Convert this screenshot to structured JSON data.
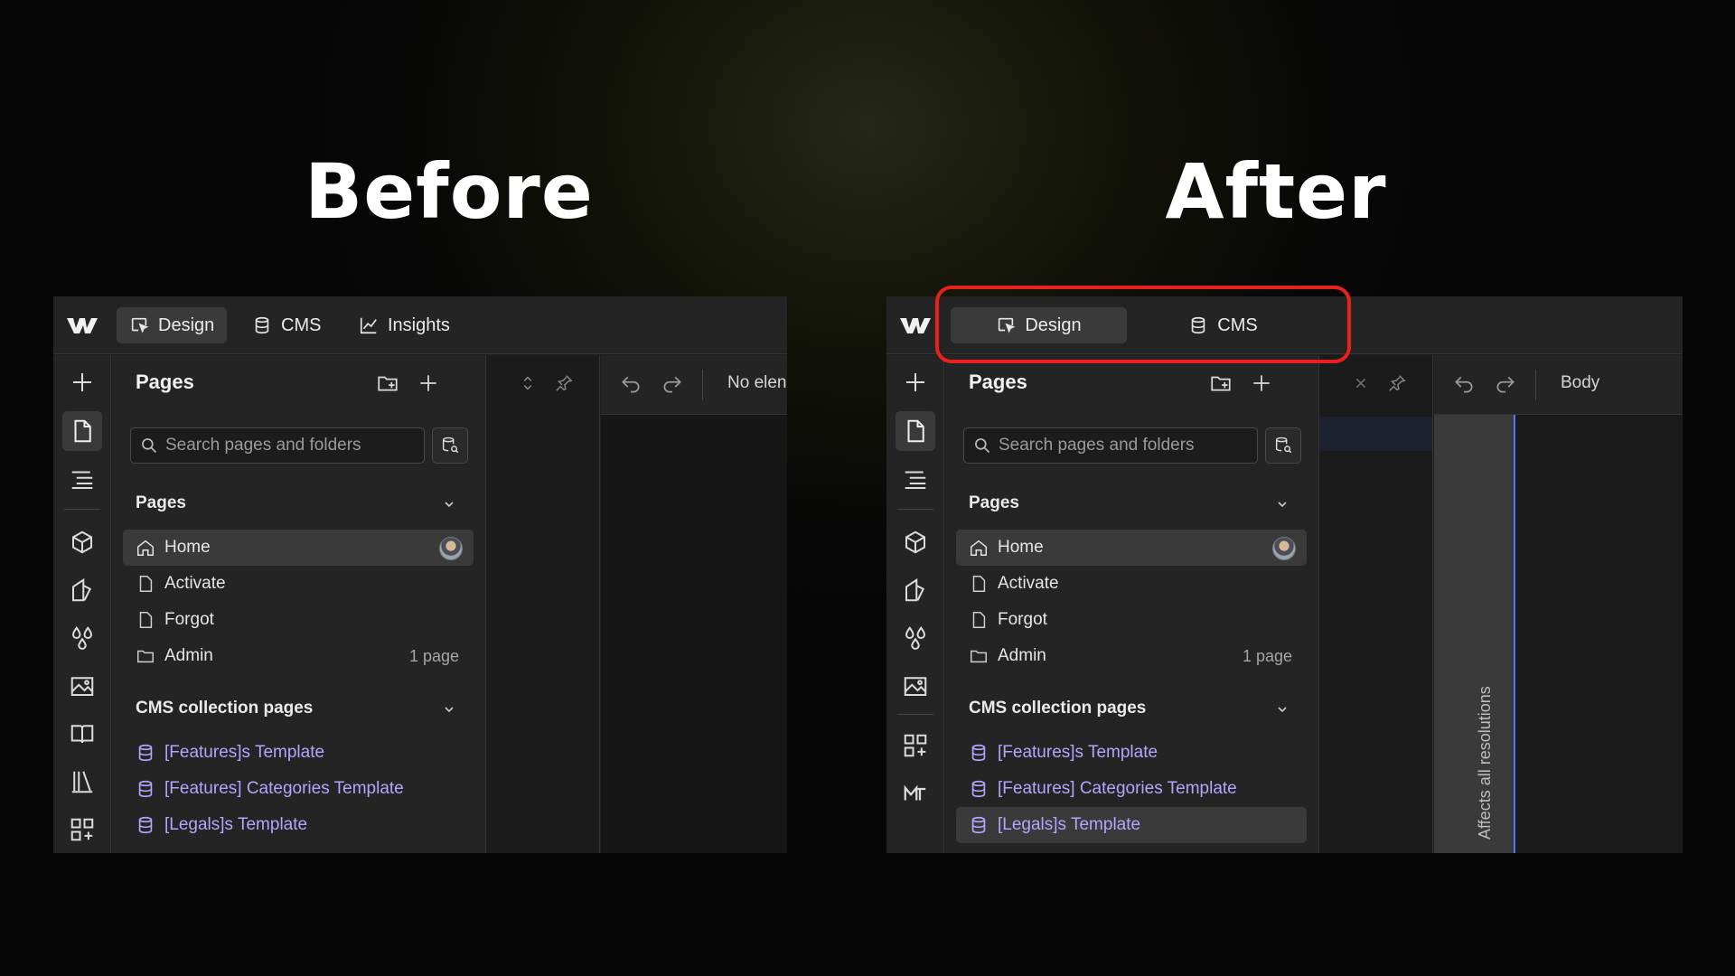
{
  "headings": {
    "before": "Before",
    "after": "After"
  },
  "colors": {
    "highlight": "#e8221b",
    "cms_link": "#b6a4ff",
    "selection": "#4a7bff"
  },
  "before": {
    "tabs": {
      "design": "Design",
      "cms": "CMS",
      "insights": "Insights"
    },
    "panel": {
      "title": "Pages",
      "search_placeholder": "Search pages and folders",
      "pages_section": "Pages",
      "pages": [
        {
          "label": "Home",
          "icon": "home-icon"
        },
        {
          "label": "Activate",
          "icon": "page-icon"
        },
        {
          "label": "Forgot",
          "icon": "page-icon"
        },
        {
          "label": "Admin",
          "icon": "folder-icon",
          "meta": "1 page"
        }
      ],
      "cms_section": "CMS collection pages",
      "cms_pages": [
        "[Features]s Template",
        "[Features] Categories Template",
        "[Legals]s Template"
      ]
    },
    "toolbar": {
      "status": "No elen"
    }
  },
  "after": {
    "tabs": {
      "design": "Design",
      "cms": "CMS"
    },
    "panel": {
      "title": "Pages",
      "search_placeholder": "Search pages and folders",
      "pages_section": "Pages",
      "pages": [
        {
          "label": "Home",
          "icon": "home-icon"
        },
        {
          "label": "Activate",
          "icon": "page-icon"
        },
        {
          "label": "Forgot",
          "icon": "page-icon"
        },
        {
          "label": "Admin",
          "icon": "folder-icon",
          "meta": "1 page"
        }
      ],
      "cms_section": "CMS collection pages",
      "cms_pages": [
        "[Features]s Template",
        "[Features] Categories Template",
        "[Legals]s Template"
      ]
    },
    "toolbar": {
      "selected": "Body"
    },
    "vertical_note": "Affects all resolutions"
  }
}
